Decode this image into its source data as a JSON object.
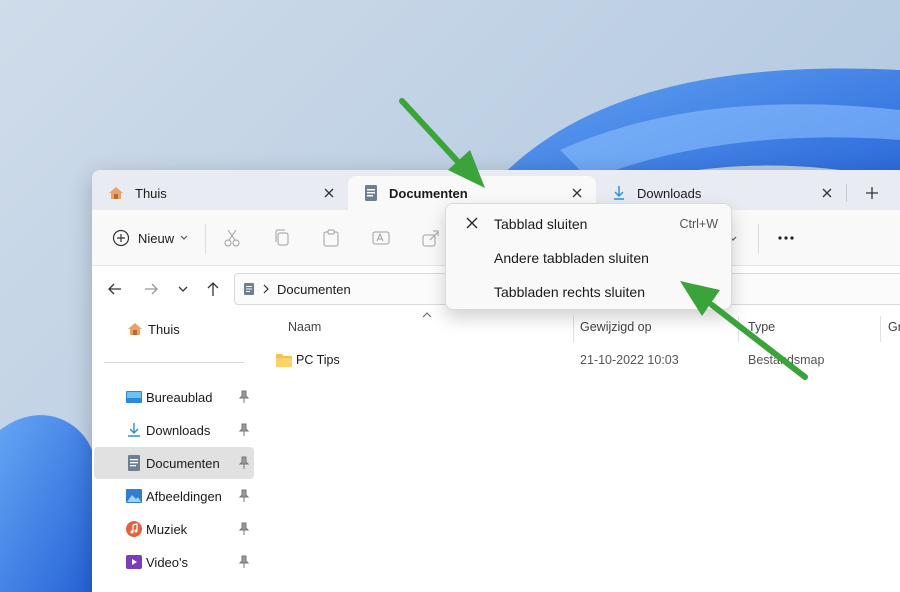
{
  "tabs": [
    {
      "label": "Thuis",
      "icon": "home-icon"
    },
    {
      "label": "Documenten",
      "icon": "document-icon"
    },
    {
      "label": "Downloads",
      "icon": "download-icon"
    }
  ],
  "toolbar": {
    "new_label": "Nieuw"
  },
  "address": {
    "path": "Documenten"
  },
  "sidebar": {
    "home": "Thuis",
    "items": [
      {
        "label": "Bureaublad",
        "icon": "desktop-icon"
      },
      {
        "label": "Downloads",
        "icon": "download-icon"
      },
      {
        "label": "Documenten",
        "icon": "document-icon",
        "selected": true
      },
      {
        "label": "Afbeeldingen",
        "icon": "pictures-icon"
      },
      {
        "label": "Muziek",
        "icon": "music-icon"
      },
      {
        "label": "Video's",
        "icon": "video-icon"
      }
    ]
  },
  "columns": {
    "name": "Naam",
    "modified": "Gewijzigd op",
    "type": "Type",
    "size": "Gr"
  },
  "files": [
    {
      "name": "PC Tips",
      "modified": "21-10-2022 10:03",
      "type": "Bestandsmap"
    }
  ],
  "context_menu": {
    "items": [
      {
        "label": "Tabblad sluiten",
        "shortcut": "Ctrl+W"
      },
      {
        "label": "Andere tabbladen sluiten"
      },
      {
        "label": "Tabbladen rechts sluiten"
      }
    ]
  },
  "colors": {
    "arrow": "#3aa33a",
    "accent": "#0067c0",
    "wallpaper": "#1f6fe0"
  }
}
